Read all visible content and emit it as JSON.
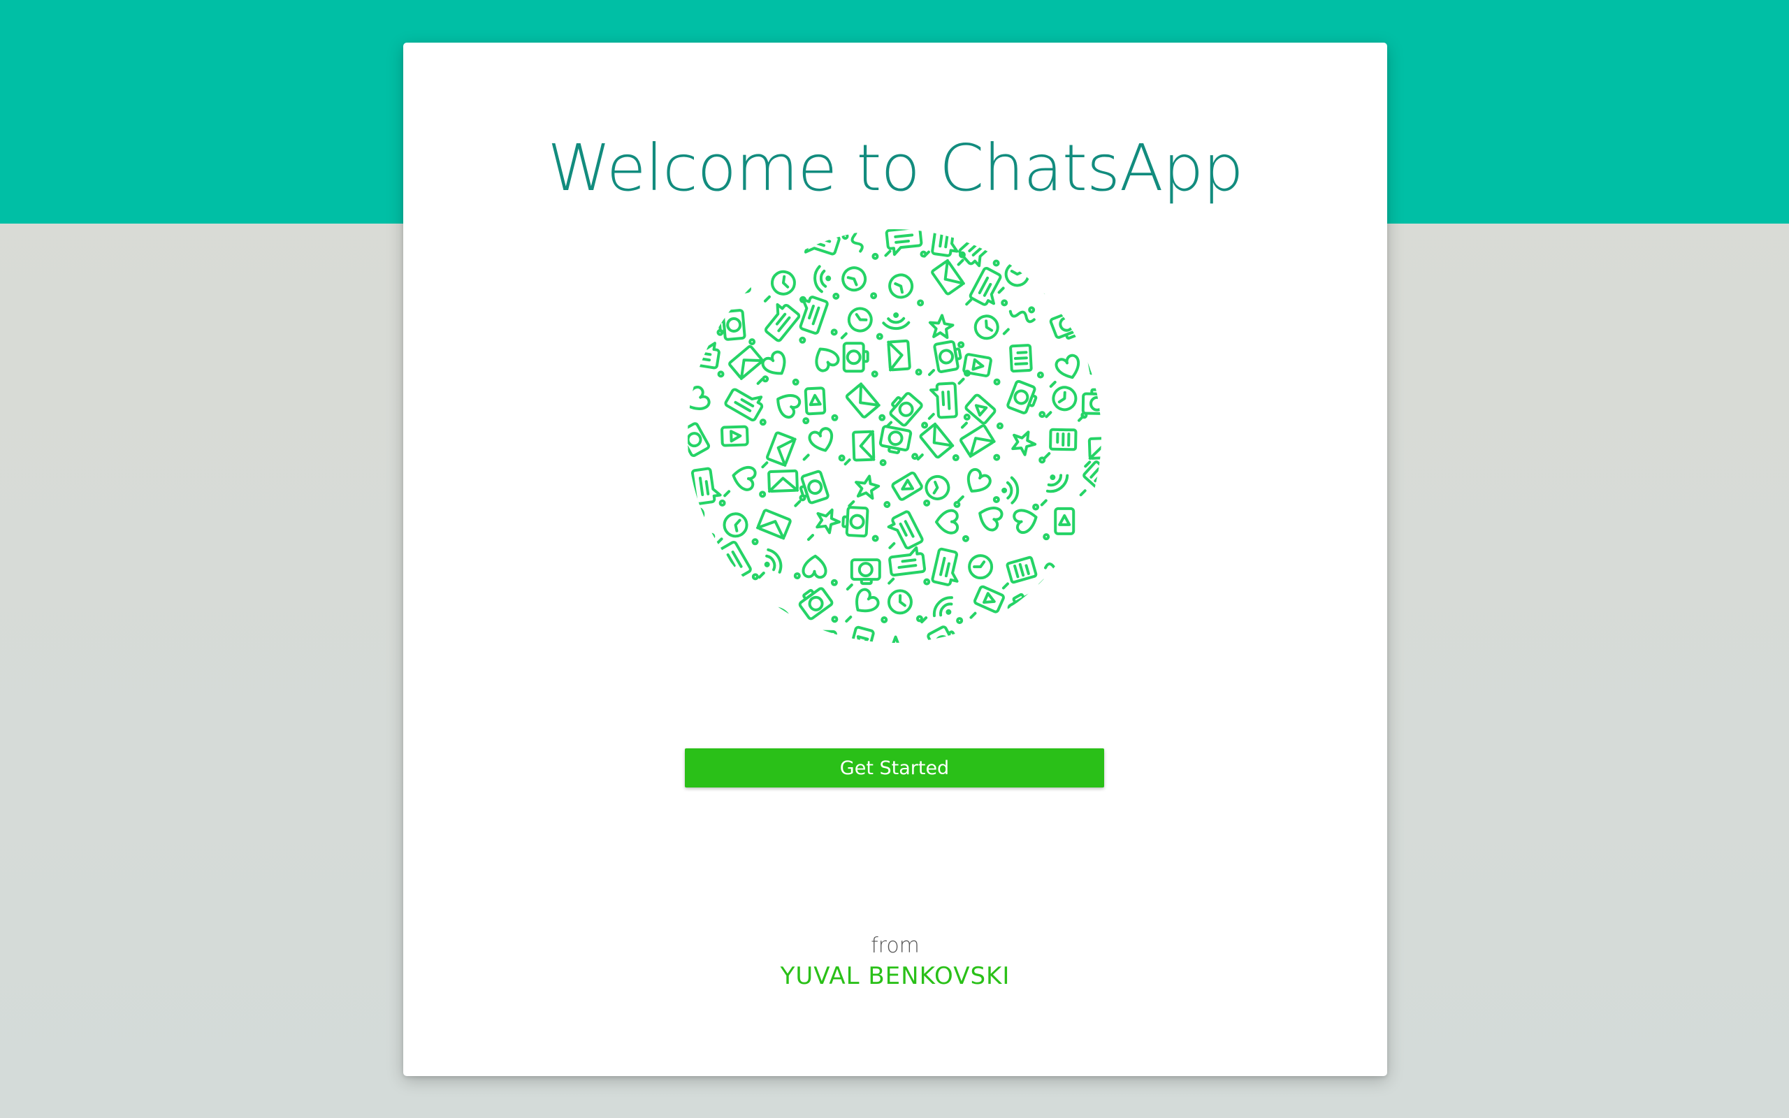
{
  "welcome": {
    "title": "Welcome to ChatsApp"
  },
  "illustration": {
    "icon": "doodle-pattern-circle",
    "color": "#25d366"
  },
  "actions": {
    "get_started_label": "Get Started"
  },
  "footer": {
    "from_label": "from",
    "author_name": "YUVAL BENKOVSKI"
  },
  "colors": {
    "header_band": "#00bfa5",
    "title": "#128c7e",
    "button": "#2ac018",
    "author": "#2ac018",
    "background": "#d9dbd6"
  }
}
